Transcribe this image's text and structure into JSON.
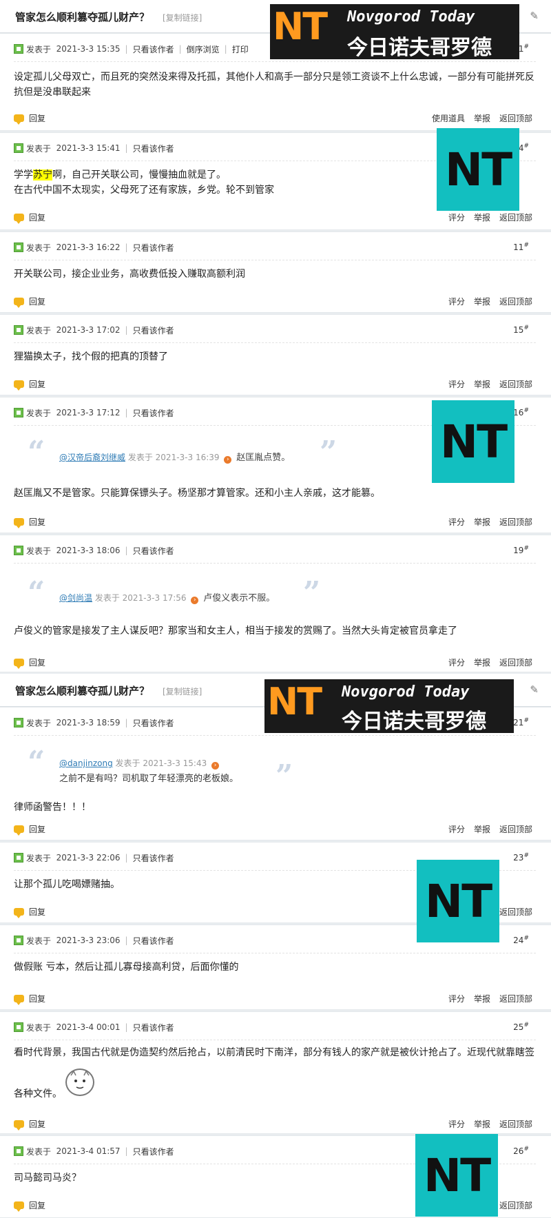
{
  "thread": {
    "title": "管家怎么顺利篡夺孤儿财产？",
    "copy_link": "[复制链接]"
  },
  "meta_labels": {
    "posted_prefix": "发表于",
    "only_author": "只看该作者",
    "reverse": "倒序浏览",
    "print": "打印"
  },
  "footer": {
    "reply": "回复",
    "use_tool": "使用道具",
    "rate": "评分",
    "report": "举报",
    "back_top": "返回顶部"
  },
  "posts": [
    {
      "time": "2021-3-3 15:35",
      "floor": "1",
      "content": "设定孤儿父母双亡，而且死的突然没来得及托孤，其他仆人和高手一部分只是领工资谈不上什么忠诚，一部分有可能拼死反抗但是没串联起来"
    },
    {
      "time": "2021-3-3 15:41",
      "floor": "4",
      "content_pre": "学学",
      "content_hl": "苏宁",
      "content_post": "啊，自己开关联公司，慢慢抽血就是了。",
      "content_line2": "在古代中国不太现实，父母死了还有家族，乡党。轮不到管家"
    },
    {
      "time": "2021-3-3 16:22",
      "floor": "11",
      "content": "开关联公司，接企业业务，高收费低投入赚取高额利润"
    },
    {
      "time": "2021-3-3 17:02",
      "floor": "15",
      "content": "狸猫换太子，找个假的把真的顶替了"
    },
    {
      "time": "2021-3-3 17:12",
      "floor": "16",
      "quote_user": "@汉帝后裔刘继威",
      "quote_time": "发表于 2021-3-3 16:39",
      "quote_text": "赵匡胤点赞。",
      "content": "赵匡胤又不是管家。只能算保镖头子。杨坚那才算管家。还和小主人亲戚，这才能篡。"
    },
    {
      "time": "2021-3-3 18:06",
      "floor": "19",
      "quote_user": "@剑尚温",
      "quote_time": "发表于 2021-3-3 17:56",
      "quote_text": "卢俊义表示不服。",
      "content": "卢俊义的管家是接发了主人谋反吧？那家当和女主人，相当于接发的赏赐了。当然大头肯定被官员拿走了"
    },
    {
      "time": "2021-3-3 18:59",
      "floor": "21",
      "quote_user": "@danjinzong",
      "quote_time": "发表于 2021-3-3 15:43",
      "quote_text": "之前不是有吗？司机取了年轻漂亮的老板娘。",
      "content": "律师函警告！！！"
    },
    {
      "time": "2021-3-3 22:06",
      "floor": "23",
      "content": "让那个孤儿吃喝嫖赌抽。"
    },
    {
      "time": "2021-3-3 23:06",
      "floor": "24",
      "content": "做假账 亏本，然后让孤儿寡母接高利贷，后面你懂的"
    },
    {
      "time": "2021-3-4 00:01",
      "floor": "25",
      "content": "看时代背景，我国古代就是伪造契约然后抢占，以前清民时下南洋，部分有钱人的家产就是被伙计抢占了。近现代就靠瞎签",
      "content_line2": "各种文件。"
    },
    {
      "time": "2021-3-4 01:57",
      "floor": "26",
      "content": "司马懿司马炎？"
    }
  ],
  "watermark": {
    "letters": "NT",
    "english": "Novgorod Today",
    "chinese": "今日诺夫哥罗德",
    "orange": "#ff9a1f",
    "teal": "#12bfc0"
  }
}
